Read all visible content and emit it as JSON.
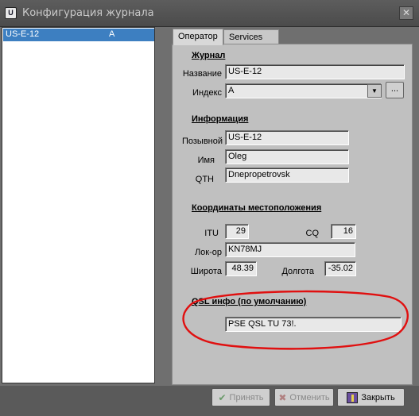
{
  "window": {
    "title": "Конфигурация журнала",
    "icon_letter": "U",
    "close_glyph": "✕"
  },
  "list": {
    "rows": [
      {
        "name": "US-E-12",
        "index": "A"
      }
    ]
  },
  "tabs": [
    {
      "label": "Оператор",
      "active": true
    },
    {
      "label": "Services",
      "active": false
    }
  ],
  "journal": {
    "section_title": "Журнал",
    "name_label": "Название",
    "name_value": "US-E-12",
    "index_label": "Индекс",
    "index_value": "A",
    "dots_label": "..."
  },
  "info": {
    "section_title": "Информация",
    "callsign_label": "Позывной",
    "callsign_value": "US-E-12",
    "name_label": "Имя",
    "name_value": "Oleg",
    "qth_label": "QTH",
    "qth_value": "Dnepropetrovsk"
  },
  "location": {
    "section_title": "Координаты местоположения",
    "itu_label": "ITU",
    "itu_value": "29",
    "cq_label": "CQ",
    "cq_value": "16",
    "locator_label": "Лок-ор",
    "locator_value": "KN78MJ",
    "lat_label": "Широта",
    "lat_value": "48.39",
    "lon_label": "Долгота",
    "lon_value": "-35.02"
  },
  "qsl": {
    "section_title": "QSL инфо (по умолчанию)",
    "value": "PSE  QSL TU 73!."
  },
  "buttons": {
    "accept": "Принять",
    "cancel": "Отменить",
    "close": "Закрыть"
  },
  "colors": {
    "selection": "#3d7fc1",
    "annotation": "#e01010"
  }
}
